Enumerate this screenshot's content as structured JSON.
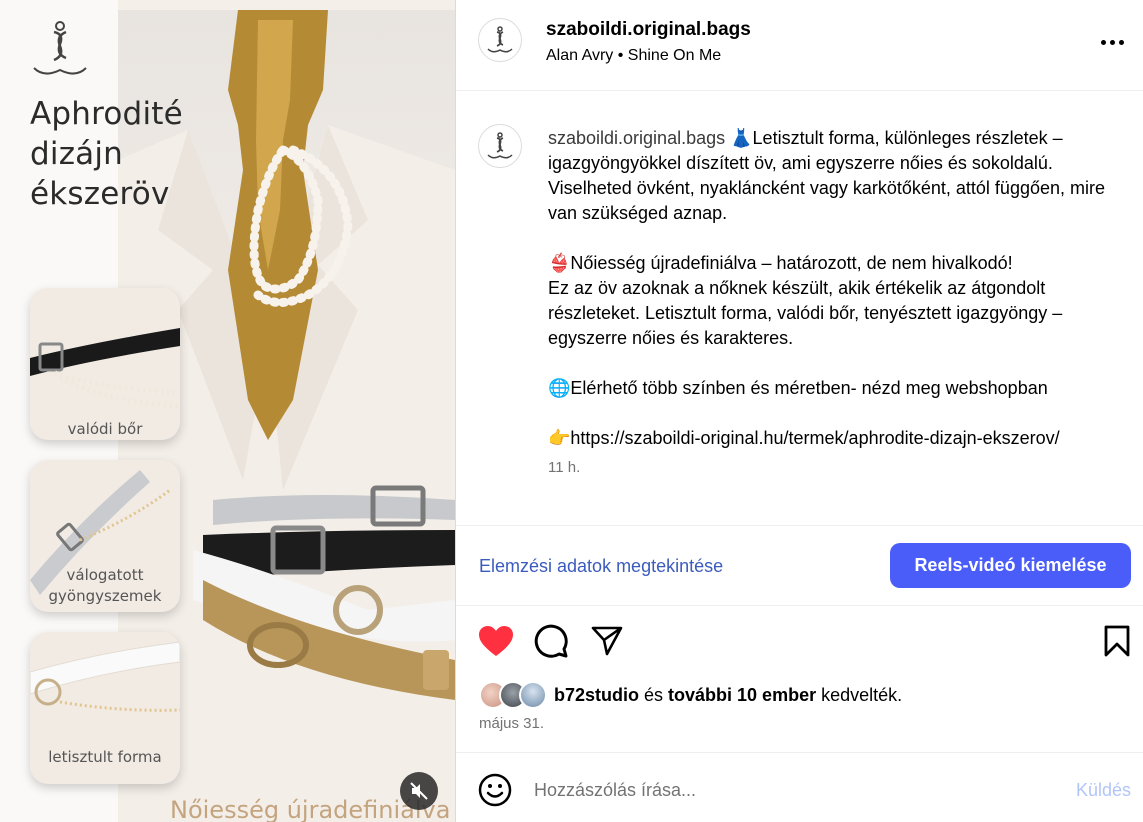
{
  "media": {
    "headline_lines": [
      "Aphrodité",
      "dizájn",
      "ékszeröv"
    ],
    "thumbnails": [
      {
        "label_lines": [
          "valódi bőr"
        ]
      },
      {
        "label_lines": [
          "válogatott",
          "gyöngyszemek"
        ]
      },
      {
        "label_lines": [
          "letisztult forma"
        ]
      }
    ],
    "footer_text": "Nőiesség újradefiniálva",
    "mute_icon": "speaker-muted-icon"
  },
  "header": {
    "username": "szaboildi.original.bags",
    "audio_artist": "Alan Avry",
    "audio_separator": " • ",
    "audio_track": "Shine On Me",
    "more_icon": "more-dots-icon"
  },
  "caption": {
    "username": "szaboildi.original.bags",
    "p1_emoji": "👗",
    "p1_text": "Letisztult forma, különleges részletek – igazgyöngyökkel díszített öv, ami egyszerre nőies és sokoldalú. Viselheted övként, nyakláncként vagy karkötőként, attól függően, mire van szükséged aznap.",
    "p2_emoji": "👙",
    "p2_line1": "Nőiesség újradefiniálva – határozott, de nem hivalkodó!",
    "p2_text": "Ez az öv azoknak a nőknek készült, akik értékelik az átgondolt részleteket. Letisztult forma, valódi bőr, tenyésztett igazgyöngy – egyszerre nőies és karakteres.",
    "p3_emoji": "🌐",
    "p3_text": "Elérhető több színben és méretben- nézd meg webshopban",
    "p4_emoji": "👉",
    "p4_text": "https://szaboildi-original.hu/termek/aphrodite-dizajn-ekszerov/",
    "time": "11 h."
  },
  "actions": {
    "insights_label": "Elemzési adatok megtekintése",
    "boost_label": "Reels-videó kiemelése"
  },
  "icons": {
    "like": "heart-filled-icon",
    "comment": "comment-icon",
    "share": "send-icon",
    "save": "bookmark-icon",
    "emoji": "emoji-smile-icon"
  },
  "likes": {
    "first_user": "b72studio",
    "connector": " és ",
    "others": "további 10 ember",
    "suffix": " kedvelték."
  },
  "post_date": "május 31.",
  "comment": {
    "placeholder": "Hozzászólás írása...",
    "send_label": "Küldés"
  },
  "colors": {
    "like_red": "#ff3040",
    "boost_blue": "#4a5df9",
    "link_blue": "#3b5bbd",
    "send_disabled": "#b2c5f9",
    "gold": "#c4a47f"
  }
}
